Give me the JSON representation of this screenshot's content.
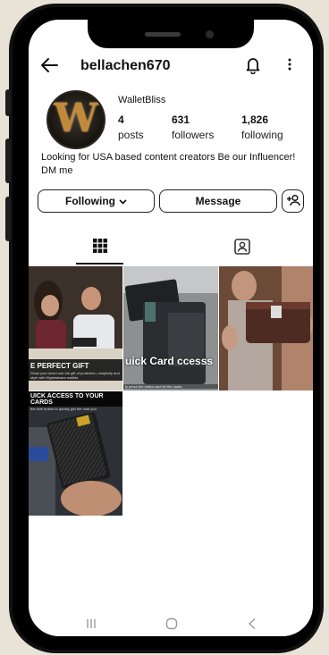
{
  "profile": {
    "username": "bellachen670",
    "display_name": "WalletBliss",
    "avatar_letter": "W",
    "bio": "Looking for USA based content creators Be our Influencer! DM me"
  },
  "stats": [
    {
      "value": "4",
      "label": "posts"
    },
    {
      "value": "631",
      "label": "followers"
    },
    {
      "value": "1,826",
      "label": "following"
    }
  ],
  "actions": {
    "following_label": "Following",
    "message_label": "Message"
  },
  "posts": [
    {
      "caption": "E PERFECT GIFT",
      "subcaption": "Show your loved one the gift of protection, simplicity and style with Highestware wallets."
    },
    {
      "caption": "uick Card ccesss",
      "subcaption": "ly press the button and let the cards"
    },
    {
      "caption": "",
      "subcaption": ""
    },
    {
      "caption": "UICK ACCESS TO YOUR CARDS",
      "subcaption": "the side button to quickly get the card you"
    }
  ],
  "icons": {
    "back": "back-arrow-icon",
    "notifications": "bell-icon",
    "more": "more-vertical-icon",
    "grid_tab": "grid-icon",
    "tagged_tab": "tagged-person-icon",
    "add_person": "add-person-icon"
  },
  "colors": {
    "background": "#e8e2d7",
    "phone": "#111111",
    "text": "#111111"
  }
}
